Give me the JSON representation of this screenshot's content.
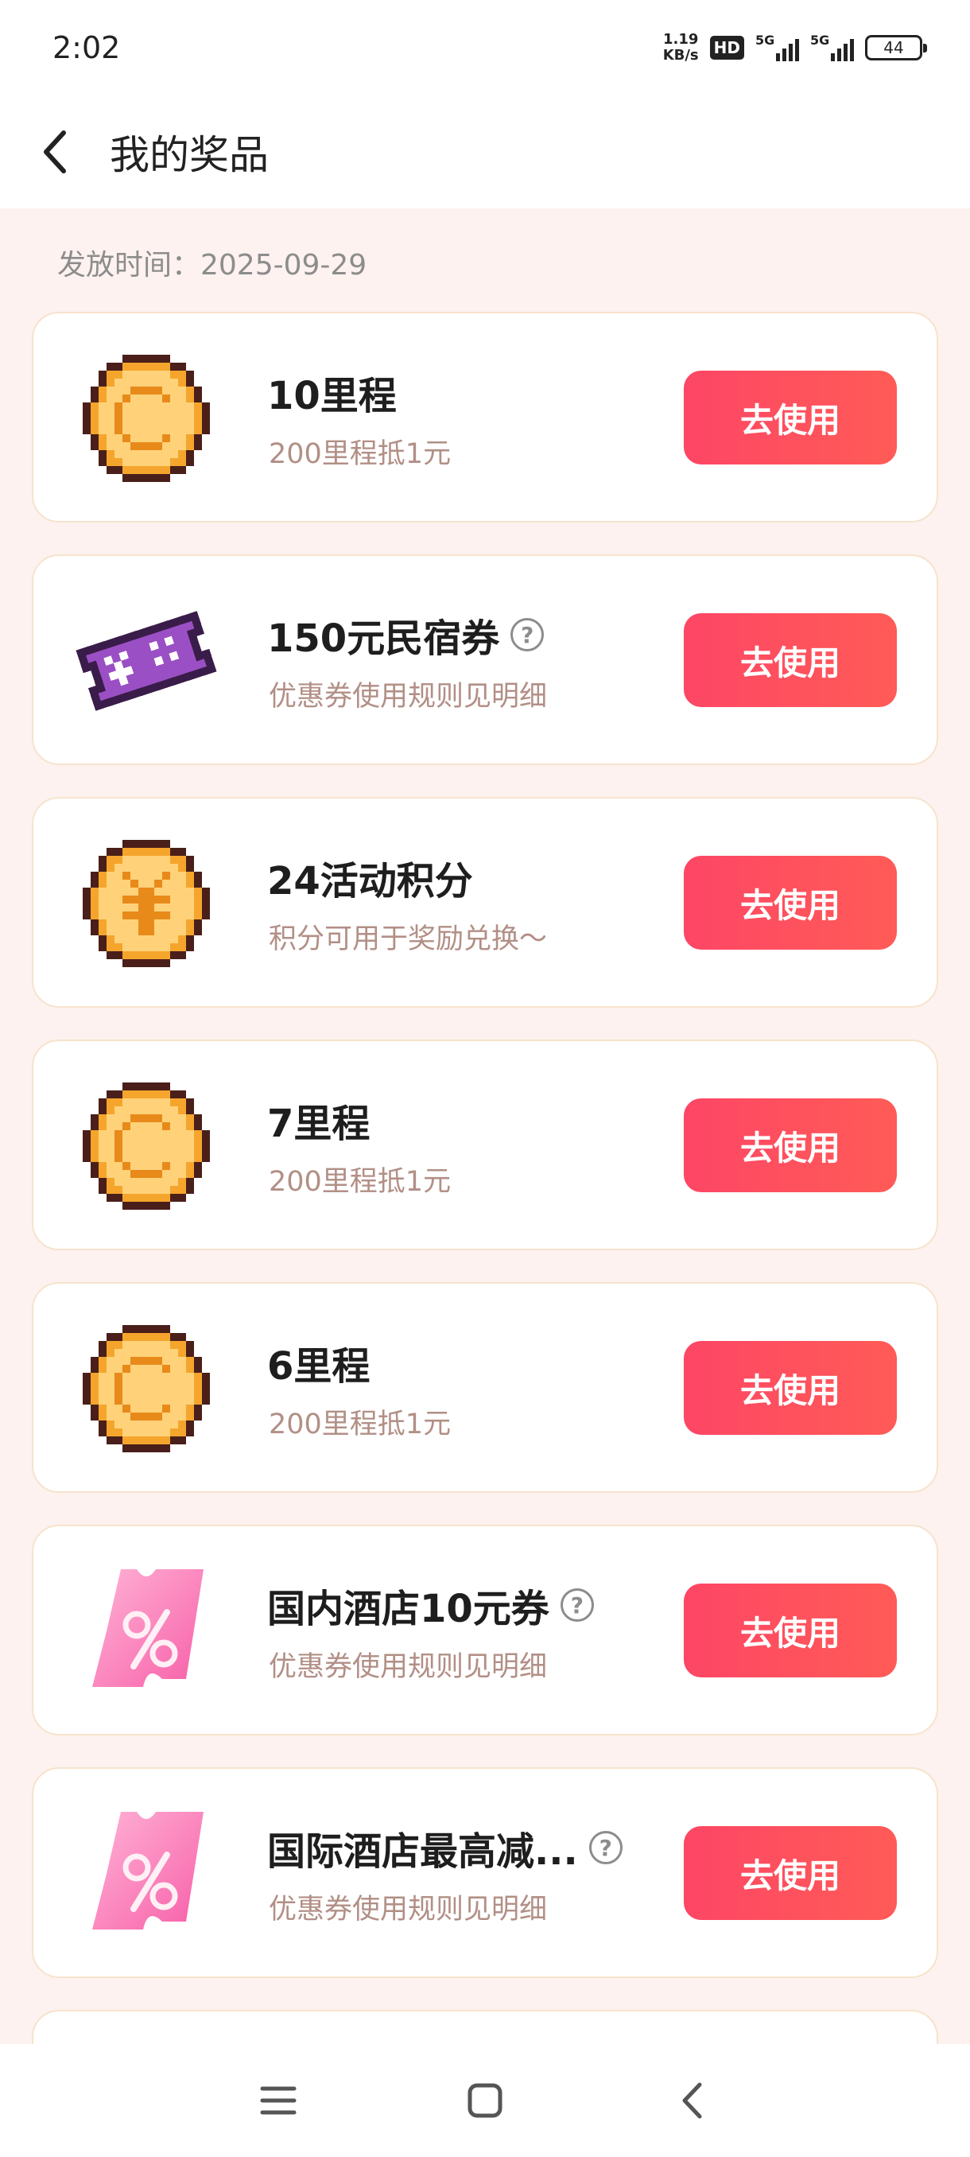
{
  "status_bar": {
    "time": "2:02",
    "net_speed_value": "1.19",
    "net_speed_unit": "KB/s",
    "hd_label": "HD",
    "signal_1_label": "5G",
    "signal_2_label": "5G",
    "battery": "44"
  },
  "header": {
    "title": "我的奖品"
  },
  "issue_date": "发放时间：2025-09-29",
  "prizes": [
    {
      "name": "10里程",
      "desc": "200里程抵1元",
      "button": "去使用",
      "icon": "pixel-coin-c-icon",
      "has_help": false
    },
    {
      "name": "150元民宿券",
      "desc": "优惠券使用规则见明细",
      "button": "去使用",
      "icon": "pixel-ticket-yen-icon",
      "has_help": true
    },
    {
      "name": "24活动积分",
      "desc": "积分可用于奖励兑换～",
      "button": "去使用",
      "icon": "pixel-coin-yen-icon",
      "has_help": false
    },
    {
      "name": "7里程",
      "desc": "200里程抵1元",
      "button": "去使用",
      "icon": "pixel-coin-c-icon",
      "has_help": false
    },
    {
      "name": "6里程",
      "desc": "200里程抵1元",
      "button": "去使用",
      "icon": "pixel-coin-c-icon",
      "has_help": false
    },
    {
      "name": "国内酒店10元券",
      "desc": "优惠券使用规则见明细",
      "button": "去使用",
      "icon": "pink-coupon-icon",
      "has_help": true
    },
    {
      "name": "国际酒店最高减...",
      "desc": "优惠券使用规则见明细",
      "button": "去使用",
      "icon": "pink-coupon-icon",
      "has_help": true
    }
  ],
  "help_symbol": "?",
  "colors": {
    "accent_start": "#fd4665",
    "accent_end": "#ff5b57",
    "page_background": "#fdf2ef",
    "card_border": "#f7e3cc",
    "desc_text": "#b28f86"
  }
}
